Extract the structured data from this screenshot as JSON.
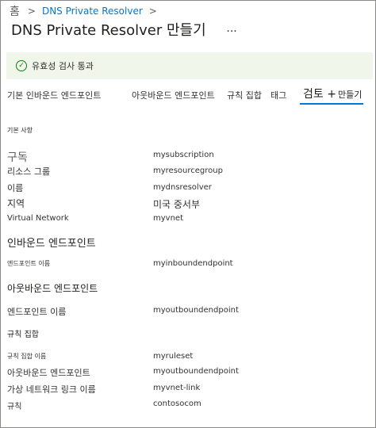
{
  "breadcrumb": {
    "home": "홈",
    "separator": ">",
    "resource": "DNS Private Resolver",
    "chevron": ">"
  },
  "page": {
    "title": "DNS  Private  Resolver 만들기",
    "more": "···"
  },
  "banner": {
    "icon": "checkmark-circle-icon",
    "text": "유효성 검사 통과",
    "color": "#107c10"
  },
  "tabs": [
    {
      "label": "기본 인바운드 엔드포인트"
    },
    {
      "label": "아웃바운드 엔드포인트"
    },
    {
      "label": "규칙 집합"
    },
    {
      "label": "태그"
    },
    {
      "label": "검토 +",
      "sub": "만들기"
    }
  ],
  "accent_color": "#0078d4",
  "review": {
    "basics_heading": "기본 사항",
    "basics": [
      {
        "label": "구독",
        "value": "mysubscription"
      },
      {
        "label": "리소스 그룹",
        "value": "myresourcegroup"
      },
      {
        "label": "이름",
        "value": "mydnsresolver"
      },
      {
        "label": "지역",
        "value": "미국 중서부"
      },
      {
        "label": "Virtual Network",
        "value": "myvnet"
      }
    ],
    "inbound_heading": "인바운드 엔드포인트",
    "inbound": [
      {
        "label": "엔드포인트 이름",
        "value": "myinboundendpoint"
      }
    ],
    "outbound_heading": "아웃바운드 엔드포인트",
    "outbound": [
      {
        "label": "엔드포인트 이름",
        "value": "myoutboundendpoint"
      }
    ],
    "ruleset_heading": "규칙 집합",
    "ruleset": [
      {
        "label": "규칙 집합 이름",
        "value": "myruleset"
      },
      {
        "label": "아웃바운드 엔드포인트",
        "value": "myoutboundendpoint"
      },
      {
        "label": "가상 네트워크 링크 이름",
        "value": "myvnet-link"
      },
      {
        "label": "규칙",
        "value": "contosocom"
      }
    ]
  }
}
